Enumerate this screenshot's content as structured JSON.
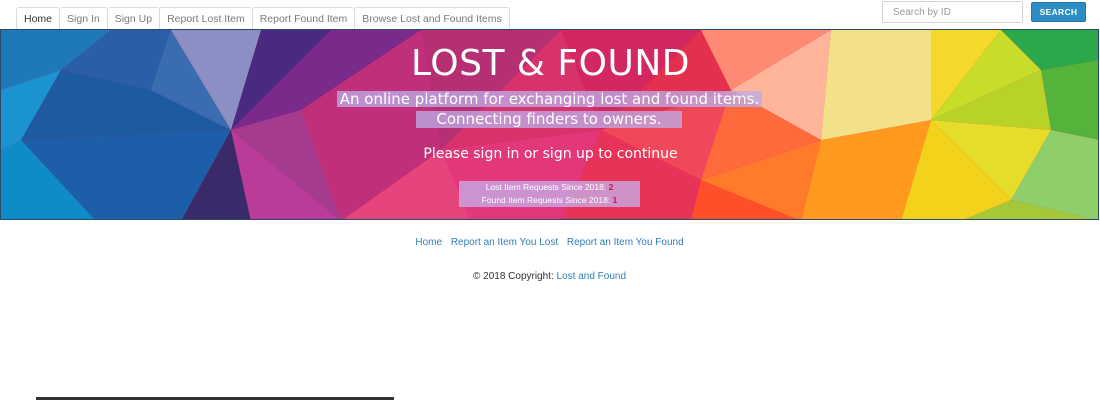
{
  "nav": {
    "tabs": [
      {
        "label": "Home"
      },
      {
        "label": "Sign In"
      },
      {
        "label": "Sign Up"
      },
      {
        "label": "Report Lost Item"
      },
      {
        "label": "Report Found Item"
      },
      {
        "label": "Browse Lost and Found Items"
      }
    ],
    "active_tab": "Home"
  },
  "search": {
    "placeholder": "Search by ID",
    "value": "",
    "button_label": "SEARCH"
  },
  "hero": {
    "title": "LOST & FOUND",
    "tagline_line1": "An online platform for exchanging lost and found items.",
    "tagline_line2": "Connecting finders to owners.",
    "prompt": "Please sign in or sign up to continue",
    "lost_label": "Lost Item Requests Since 2018:",
    "lost_count": "2",
    "found_label": "Found Item Requests Since 2018:",
    "found_count": "1"
  },
  "footer": {
    "links": [
      {
        "label": "Home"
      },
      {
        "label": "Report an Item You Lost"
      },
      {
        "label": "Report an Item You Found"
      }
    ],
    "copyright_prefix": "© 2018 Copyright:",
    "copyright_link": "Lost and Found"
  },
  "colors": {
    "accent": "#2b8cc4",
    "link": "#2f7fb5",
    "count_highlight": "#c0185a"
  }
}
